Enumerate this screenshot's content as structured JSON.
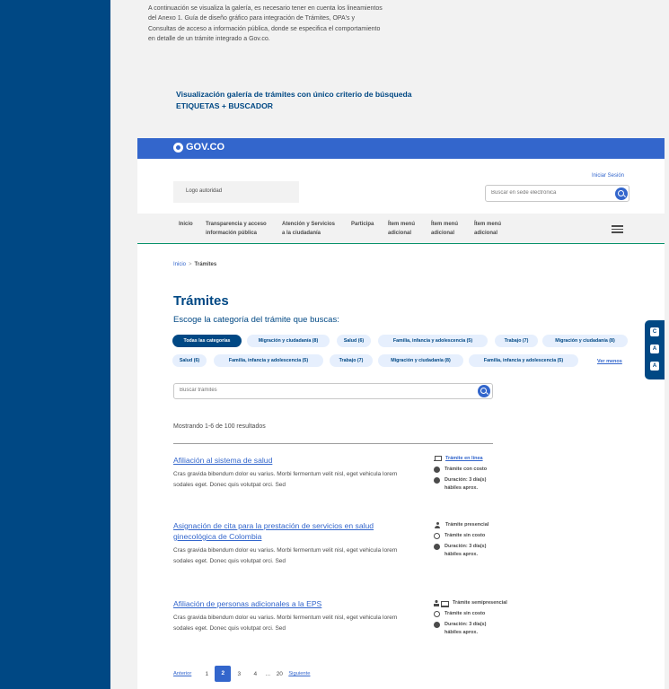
{
  "doc": {
    "intro_text": "A continuación se visualiza la galería, es necesario tener en cuenta los lineamientos del Anexo 1. Guía de diseño gráfico para integración de Trámites, OPA's y Consultas de acceso a información pública, donde se especifica el comportamiento en detalle de un trámite integrado a Gov.co.",
    "section_title_line1": "Visualización galería de trámites con único criterio de búsqueda",
    "section_title_line2": "ETIQUETAS + BUSCADOR"
  },
  "header": {
    "logo_text": "GOV.CO",
    "login_label": "Iniciar Sesión",
    "logo_autoridad": "Logo autoridad",
    "search_placeholder": "Buscar en sede electrónica"
  },
  "menu": {
    "items": [
      {
        "line1": "Inicio",
        "line2": ""
      },
      {
        "line1": "Transparencia y acceso",
        "line2": "información pública"
      },
      {
        "line1": "Atención y Servicios",
        "line2": "a la ciudadanía"
      },
      {
        "line1": "Participa",
        "line2": ""
      },
      {
        "line1": "Ítem menú",
        "line2": "adicional"
      },
      {
        "line1": "Ítem menú",
        "line2": "adicional"
      },
      {
        "line1": "Ítem menú",
        "line2": "adicional"
      }
    ]
  },
  "breadcrumb": {
    "home": "Inicio",
    "separator": ">",
    "current": "Trámites"
  },
  "page": {
    "title": "Trámites",
    "subtitle": "Escoge la categoría del trámite que buscas:"
  },
  "chips": {
    "row1": [
      "Todas las categorías",
      "Migración y ciudadanía (8)",
      "Salud (6)",
      "Familia, infancia y adolescencia (5)",
      "Trabajo (7)",
      "Migración y ciudadanía (8)"
    ],
    "row2": [
      "Salud (6)",
      "Familia, infancia y adolescencia (5)",
      "Trabajo (7)",
      "Migración y ciudadanía (8)",
      "Familia, infancia y adolescencia (5)"
    ],
    "ver_menos": "Ver menos"
  },
  "tramite_search": {
    "placeholder": "Buscar trámites"
  },
  "results": {
    "count_text": "Mostrando 1-6 de 100 resultados",
    "items": [
      {
        "title": "Afiliación al sistema de salud",
        "description": "Cras gravida bibendum dolor eu varius. Morbi fermentum velit nisl, eget vehicula lorem sodales eget. Donec quis volutpat orci. Sed",
        "modality": "Trámite en línea",
        "cost": "Trámite con costo",
        "duration_line1": "Duración: 3 día(s)",
        "duration_line2": "hábiles aprox."
      },
      {
        "title": "Asignación de cita para la prestación de servicios en salud ginecológica de Colombia",
        "description": "Cras gravida bibendum dolor eu varius. Morbi fermentum velit nisl, eget vehicula lorem sodales eget. Donec quis volutpat orci. Sed",
        "modality": "Trámite presencial",
        "cost": "Trámite sin costo",
        "duration_line1": "Duración: 3 día(s)",
        "duration_line2": "hábiles aprox."
      },
      {
        "title": "Afiliación de personas adicionales a la EPS",
        "description": "Cras gravida bibendum dolor eu varius. Morbi fermentum velit nisl, eget vehicula lorem sodales eget. Donec quis volutpat orci. Sed",
        "modality": "Trámite semipresencial",
        "cost": "Trámite sin costo",
        "duration_line1": "Duración: 3 día(s)",
        "duration_line2": "hábiles aprox."
      }
    ]
  },
  "pagination": {
    "prev": "Anterior",
    "pages": [
      "1",
      "2",
      "3",
      "4"
    ],
    "ellipsis": "...",
    "last": "20",
    "next": "Siguiente",
    "current": "2"
  },
  "accessibility": {
    "buttons": [
      "C",
      "A",
      "A"
    ]
  },
  "colors": {
    "gov_blue": "#3366cc",
    "dark_blue": "#004884",
    "chip_bg": "#e6effd",
    "menu_border": "#069169"
  }
}
